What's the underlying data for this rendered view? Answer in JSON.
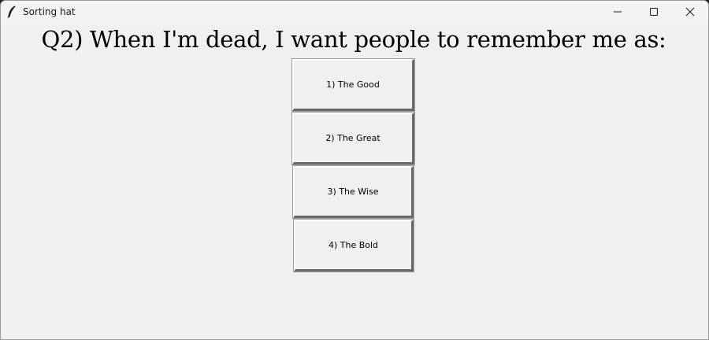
{
  "window": {
    "title": "Sorting hat",
    "icon": "feather-icon",
    "controls": [
      "minimize-icon",
      "maximize-icon",
      "close-icon"
    ]
  },
  "question": {
    "text": "Q2) When I'm dead, I want people to remember me as:"
  },
  "answers": [
    {
      "label": "1) The Good"
    },
    {
      "label": "2) The Great"
    },
    {
      "label": "3) The Wise"
    },
    {
      "label": "4) The Bold"
    }
  ]
}
